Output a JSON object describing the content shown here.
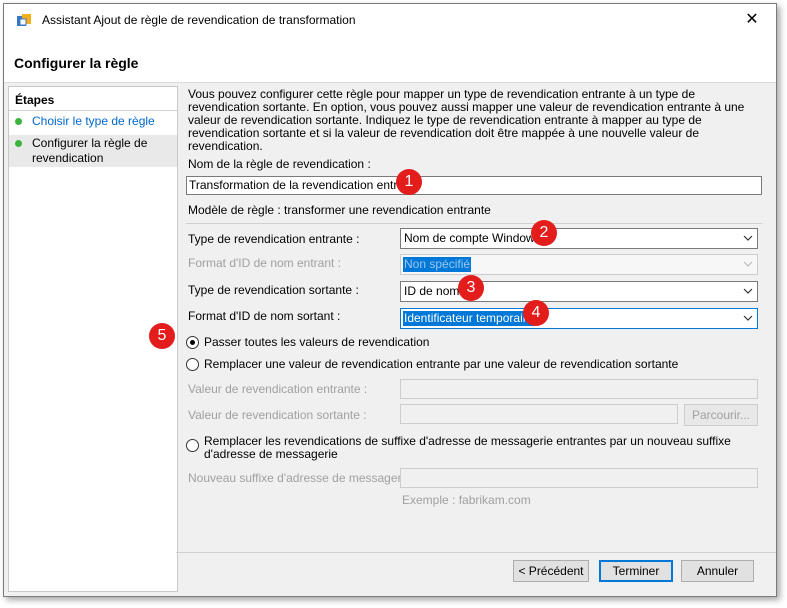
{
  "window": {
    "title": "Assistant Ajout de règle de revendication de transformation",
    "close_symbol": "✕"
  },
  "header": {
    "title": "Configurer la règle"
  },
  "steps": {
    "title": "Étapes",
    "items": [
      {
        "label": "Choisir le type de règle"
      },
      {
        "label": "Configurer la règle de revendication"
      }
    ]
  },
  "form": {
    "intro": "Vous pouvez configurer cette règle pour mapper un type de revendication entrante à un type de revendication sortante. En option, vous pouvez aussi mapper une valeur de revendication entrante à une valeur de revendication sortante. Indiquez le type de revendication entrante à mapper au type de revendication sortante et si la valeur de revendication doit être mappée à une nouvelle valeur de revendication.",
    "rule_name_label": "Nom de la règle de revendication :",
    "rule_name_value": "Transformation de la revendication entrante",
    "template_label": "Modèle de règle : transformer une revendication entrante",
    "incoming_type_label": "Type de revendication entrante :",
    "incoming_type_value": "Nom de compte Windows",
    "incoming_format_label": "Format d'ID de nom entrant :",
    "incoming_format_value": "Non spécifié",
    "outgoing_type_label": "Type de revendication sortante :",
    "outgoing_type_value": "ID de nom",
    "outgoing_format_label": "Format d'ID de nom sortant :",
    "outgoing_format_value": "Identificateur temporaire",
    "radio_pass_all": "Passer toutes les valeurs de revendication",
    "radio_replace_value": "Remplacer une valeur de revendication entrante par une valeur de revendication sortante",
    "incoming_value_label": "Valeur de revendication entrante :",
    "outgoing_value_label": "Valeur de revendication sortante :",
    "browse_button": "Parcourir...",
    "radio_replace_suffix": "Remplacer les revendications de suffixe d'adresse de messagerie entrantes par un nouveau suffixe d'adresse de messagerie",
    "new_suffix_label": "Nouveau suffixe d'adresse de messagerie :",
    "example_text": "Exemple : fabrikam.com",
    "selected_radio": "pass_all"
  },
  "footer": {
    "previous": "< Précédent",
    "finish": "Terminer",
    "cancel": "Annuler"
  },
  "callouts": [
    "1",
    "2",
    "3",
    "4",
    "5"
  ],
  "colors": {
    "callout": "#e31c1c",
    "selection": "#0078d7",
    "step_done": "#3cb43c",
    "link": "#0066cc"
  },
  "icons": {
    "window": "app-icon",
    "chevron": "chevron-down-icon",
    "step": "green-dot-icon"
  }
}
